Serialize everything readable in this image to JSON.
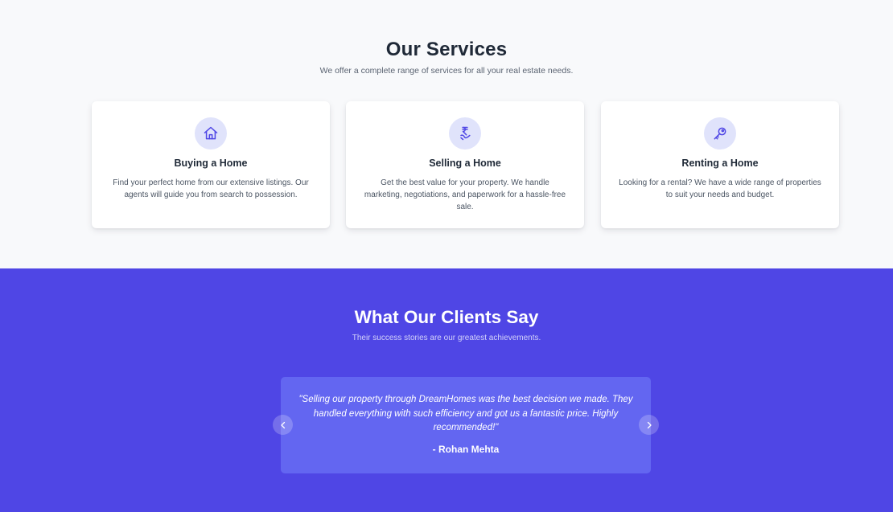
{
  "services": {
    "title": "Our Services",
    "subtitle": "We offer a complete range of services for all your real estate needs.",
    "cards": [
      {
        "icon": "house-icon",
        "title": "Buying a Home",
        "text": "Find your perfect home from our extensive listings. Our agents will guide you from search to possession."
      },
      {
        "icon": "rupee-hand-icon",
        "title": "Selling a Home",
        "text": "Get the best value for your property. We handle marketing, negotiations, and paperwork for a hassle-free sale."
      },
      {
        "icon": "key-icon",
        "title": "Renting a Home",
        "text": "Looking for a rental? We have a wide range of properties to suit your needs and budget."
      }
    ]
  },
  "clients": {
    "title": "What Our Clients Say",
    "subtitle": "Their success stories are our greatest achievements.",
    "testimonial": {
      "quote": "\"Selling our property through DreamHomes was the best decision we made. They handled everything with such efficiency and got us a fantastic price. Highly recommended!\"",
      "author": "- Rohan Mehta"
    },
    "prev_icon": "chevron-left-icon",
    "next_icon": "chevron-right-icon"
  },
  "colors": {
    "accent": "#4f46e5",
    "testimonial_bg": "#6366f1",
    "icon_bg": "#e0e3fb",
    "icon_stroke": "#4f46e5"
  }
}
